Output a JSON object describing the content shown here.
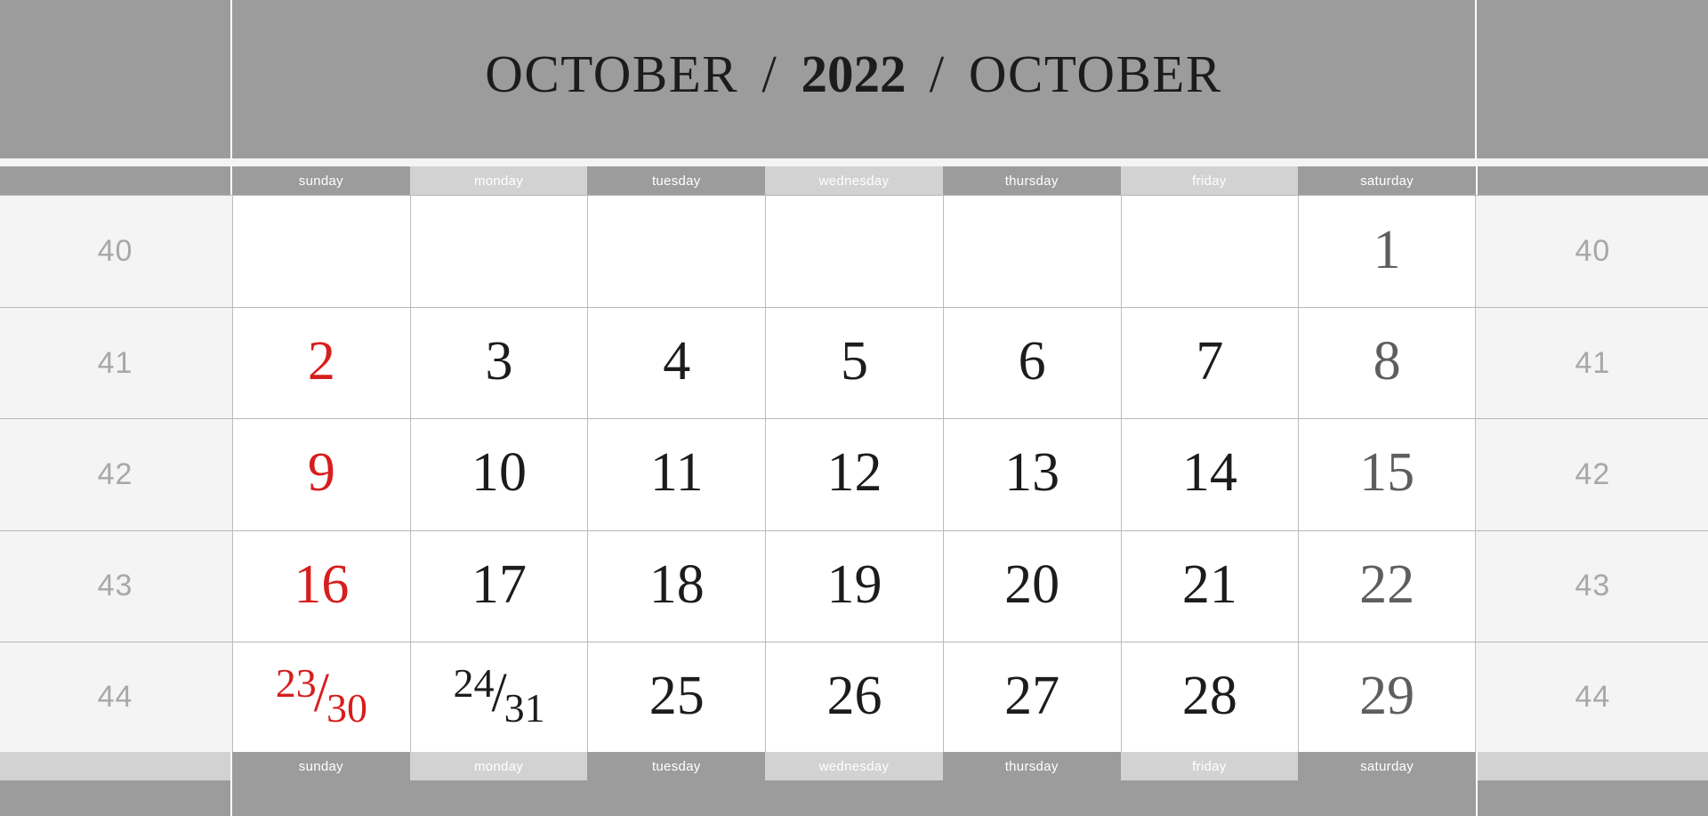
{
  "header": {
    "month_left": "OCTOBER",
    "separator_left": "/",
    "year": "2022",
    "separator_right": "/",
    "month_right": "OCTOBER"
  },
  "weekdays": [
    "sunday",
    "monday",
    "tuesday",
    "wednesday",
    "thursday",
    "friday",
    "saturday"
  ],
  "week_numbers": [
    "40",
    "41",
    "42",
    "43",
    "44"
  ],
  "colors": {
    "band_gray": "#9c9c9c",
    "weekday_dark": "#9c9c9c",
    "weekday_light": "#d2d2d2",
    "week_number_bg": "#f4f4f4",
    "week_number_text": "#a8a8a8",
    "sunday_red": "#d81d1d",
    "weekday_black": "#1c1c1c",
    "saturday_gray": "#5e5e5e",
    "grid_line": "#bdbdbd"
  },
  "weeks": [
    {
      "number": "40",
      "days": [
        {
          "text": "",
          "type": "empty"
        },
        {
          "text": "",
          "type": "empty"
        },
        {
          "text": "",
          "type": "empty"
        },
        {
          "text": "",
          "type": "empty"
        },
        {
          "text": "",
          "type": "empty"
        },
        {
          "text": "",
          "type": "empty"
        },
        {
          "text": "1",
          "type": "saturday"
        }
      ]
    },
    {
      "number": "41",
      "days": [
        {
          "text": "2",
          "type": "sunday"
        },
        {
          "text": "3",
          "type": "weekday"
        },
        {
          "text": "4",
          "type": "weekday"
        },
        {
          "text": "5",
          "type": "weekday"
        },
        {
          "text": "6",
          "type": "weekday"
        },
        {
          "text": "7",
          "type": "weekday"
        },
        {
          "text": "8",
          "type": "saturday"
        }
      ]
    },
    {
      "number": "42",
      "days": [
        {
          "text": "9",
          "type": "sunday"
        },
        {
          "text": "10",
          "type": "weekday"
        },
        {
          "text": "11",
          "type": "weekday"
        },
        {
          "text": "12",
          "type": "weekday"
        },
        {
          "text": "13",
          "type": "weekday"
        },
        {
          "text": "14",
          "type": "weekday"
        },
        {
          "text": "15",
          "type": "saturday"
        }
      ]
    },
    {
      "number": "43",
      "days": [
        {
          "text": "16",
          "type": "sunday"
        },
        {
          "text": "17",
          "type": "weekday"
        },
        {
          "text": "18",
          "type": "weekday"
        },
        {
          "text": "19",
          "type": "weekday"
        },
        {
          "text": "20",
          "type": "weekday"
        },
        {
          "text": "21",
          "type": "weekday"
        },
        {
          "text": "22",
          "type": "saturday"
        }
      ]
    },
    {
      "number": "44",
      "days": [
        {
          "text": "23/30",
          "type": "sunday",
          "split": [
            "23",
            "/",
            "30"
          ]
        },
        {
          "text": "24/31",
          "type": "weekday",
          "split": [
            "24",
            "/",
            "31"
          ]
        },
        {
          "text": "25",
          "type": "weekday"
        },
        {
          "text": "26",
          "type": "weekday"
        },
        {
          "text": "27",
          "type": "weekday"
        },
        {
          "text": "28",
          "type": "weekday"
        },
        {
          "text": "29",
          "type": "saturday"
        }
      ]
    }
  ]
}
